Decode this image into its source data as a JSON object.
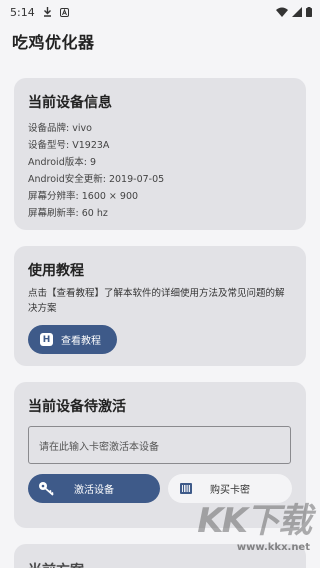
{
  "status_bar": {
    "time": "5:14"
  },
  "app": {
    "title": "吃鸡优化器"
  },
  "device_card": {
    "title": "当前设备信息",
    "rows": [
      {
        "label": "设备品牌:",
        "value": "vivo"
      },
      {
        "label": "设备型号:",
        "value": "V1923A"
      },
      {
        "label": "Android版本:",
        "value": "9"
      },
      {
        "label": "Android安全更新:",
        "value": "2019-07-05"
      },
      {
        "label": "屏幕分辨率:",
        "value": "1600 × 900"
      },
      {
        "label": "屏幕刷新率:",
        "value": "60 hz"
      }
    ]
  },
  "tutorial_card": {
    "title": "使用教程",
    "description": "点击【查看教程】了解本软件的详细使用方法及常见问题的解决方案",
    "button_label": "查看教程",
    "button_icon_letter": "H"
  },
  "activate_card": {
    "title": "当前设备待激活",
    "input_placeholder": "请在此输入卡密激活本设备",
    "activate_label": "激活设备",
    "buy_label": "购买卡密"
  },
  "next_card": {
    "title": "当前方案"
  },
  "watermark": {
    "brand": "KK下载",
    "url": "www.kkx.net"
  },
  "colors": {
    "accent": "#3e5a89",
    "card_bg": "#e2e2e6",
    "page_bg": "#f5f5f7"
  }
}
